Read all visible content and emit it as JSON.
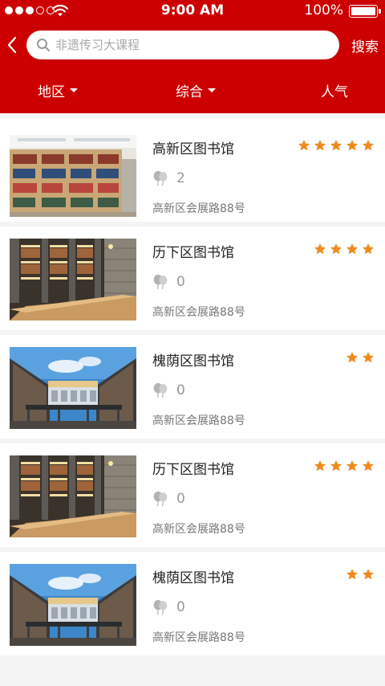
{
  "status_bar": {
    "time": "9:00 AM",
    "battery": "100%"
  },
  "search": {
    "placeholder": "非遗传习大课程",
    "button_label": "搜索"
  },
  "filters": [
    {
      "label": "地区",
      "has_dropdown": true
    },
    {
      "label": "综合",
      "has_dropdown": true
    },
    {
      "label": "人气",
      "has_dropdown": false
    }
  ],
  "colors": {
    "brand": "#cc0000",
    "star": "#ee8a1d",
    "muted": "#999999"
  },
  "items": [
    {
      "title": "高新区图书馆",
      "rating": 5,
      "likes": "2",
      "address": "高新区会展路88号",
      "image": "bookshelves"
    },
    {
      "title": "历下区图书馆",
      "rating": 4,
      "likes": "0",
      "address": "高新区会展路88号",
      "image": "reading-hall"
    },
    {
      "title": "槐荫区图书馆",
      "rating": 2,
      "likes": "0",
      "address": "高新区会展路88号",
      "image": "building-exterior"
    },
    {
      "title": "历下区图书馆",
      "rating": 4,
      "likes": "0",
      "address": "高新区会展路88号",
      "image": "reading-hall"
    },
    {
      "title": "槐荫区图书馆",
      "rating": 2,
      "likes": "0",
      "address": "高新区会展路88号",
      "image": "building-exterior"
    }
  ]
}
